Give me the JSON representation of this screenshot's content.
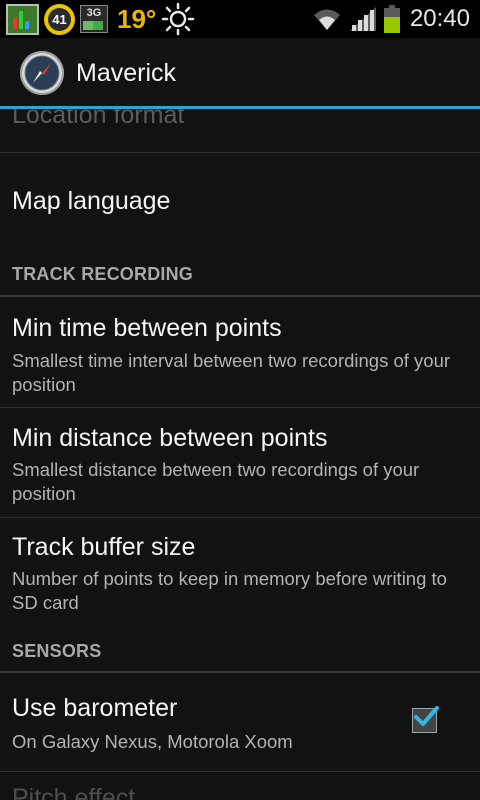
{
  "status_bar": {
    "badge_number": "41",
    "network_type": "3G",
    "temperature": "19°",
    "time": "20:40",
    "battery_color": "#98c700",
    "signal_color": "#dcdcdc",
    "weather_icon": "sun-icon"
  },
  "action_bar": {
    "title": "Maverick",
    "accent_color": "#2ba4d6"
  },
  "settings": {
    "partial_top_label": "Location format",
    "map_language": "Map language",
    "track_recording_header": "TRACK RECORDING",
    "items": [
      {
        "title": "Min time between points",
        "summary": "Smallest time interval between two recordings of your position"
      },
      {
        "title": "Min distance between points",
        "summary": "Smallest distance between two recordings of your position"
      },
      {
        "title": "Track buffer size",
        "summary": "Number of points to keep in memory before writing to SD card"
      }
    ],
    "sensors_header": "SENSORS",
    "barometer": {
      "title": "Use barometer",
      "summary": "On Galaxy Nexus, Motorola Xoom",
      "checked": true
    },
    "partial_bottom_label": "Pitch effect"
  }
}
